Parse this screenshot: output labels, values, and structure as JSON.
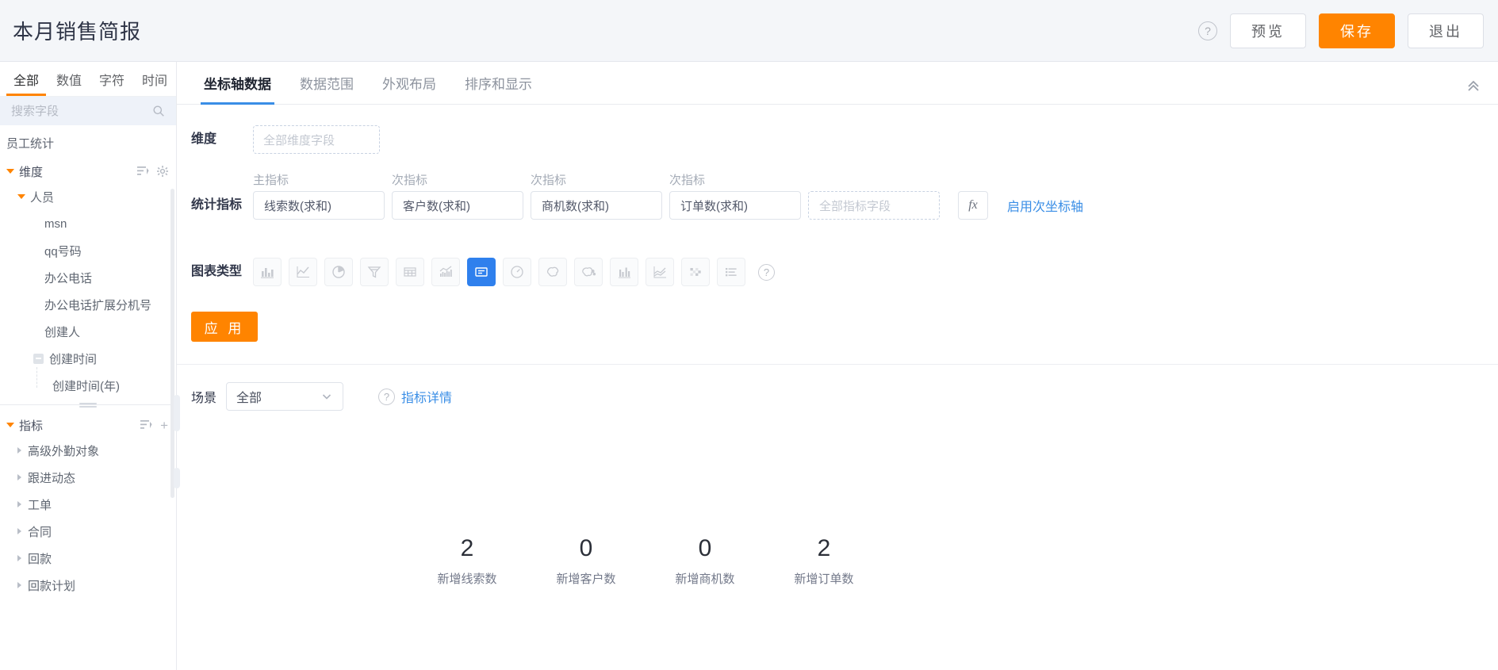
{
  "header": {
    "title": "本月销售简报",
    "help_icon": "question-circle-icon",
    "buttons": [
      {
        "label": "预览",
        "style": "outline"
      },
      {
        "label": "保存",
        "style": "primary"
      },
      {
        "label": "退出",
        "style": "outline"
      }
    ]
  },
  "sidebar": {
    "field_tabs": [
      {
        "label": "全部",
        "active": true
      },
      {
        "label": "数值",
        "active": false
      },
      {
        "label": "字符",
        "active": false
      },
      {
        "label": "时间",
        "active": false
      }
    ],
    "search": {
      "placeholder": "搜索字段",
      "value": "",
      "icon": "search-icon"
    },
    "dataset_name": "员工统计",
    "dimension_group": {
      "label": "维度",
      "filter_icon": "filter-sort-icon",
      "settings_icon": "gear-icon",
      "children": [
        {
          "label": "人员",
          "level": 1,
          "expanded": true
        },
        {
          "label": "msn",
          "level": 2
        },
        {
          "label": "qq号码",
          "level": 2
        },
        {
          "label": "办公电话",
          "level": 2
        },
        {
          "label": "办公电话扩展分机号",
          "level": 2
        },
        {
          "label": "创建人",
          "level": 2
        },
        {
          "label": "创建时间",
          "level": 2,
          "collapsible": true
        },
        {
          "label": "创建时间(年)",
          "level": 3
        }
      ]
    },
    "metric_group": {
      "label": "指标",
      "filter_icon": "filter-sort-icon",
      "add_icon": "plus-icon",
      "children": [
        {
          "label": "高级外勤对象"
        },
        {
          "label": "跟进动态"
        },
        {
          "label": "工单"
        },
        {
          "label": "合同"
        },
        {
          "label": "回款"
        },
        {
          "label": "回款计划"
        }
      ]
    }
  },
  "main": {
    "tabs": [
      {
        "label": "坐标轴数据",
        "active": true
      },
      {
        "label": "数据范围",
        "active": false
      },
      {
        "label": "外观布局",
        "active": false
      },
      {
        "label": "排序和显示",
        "active": false
      }
    ],
    "collapse_icon": "chevron-double-up-icon",
    "dimension": {
      "label": "维度",
      "placeholder": "全部维度字段"
    },
    "metrics": {
      "label": "统计指标",
      "column_labels": [
        "主指标",
        "次指标",
        "次指标",
        "次指标"
      ],
      "values": [
        "线索数(求和)",
        "客户数(求和)",
        "商机数(求和)",
        "订单数(求和)"
      ],
      "empty_placeholder": "全部指标字段",
      "fx_label": "fx",
      "secondary_axis_link": "启用次坐标轴"
    },
    "chart_type": {
      "label": "图表类型",
      "help_icon": "question-circle-icon",
      "options": [
        {
          "name": "bar-chart-icon",
          "selected": false
        },
        {
          "name": "line-chart-icon",
          "selected": false
        },
        {
          "name": "pie-chart-icon",
          "selected": false
        },
        {
          "name": "funnel-chart-icon",
          "selected": false
        },
        {
          "name": "table-icon",
          "selected": false
        },
        {
          "name": "area-chart-icon",
          "selected": false
        },
        {
          "name": "indicator-card-icon",
          "selected": true
        },
        {
          "name": "gauge-chart-icon",
          "selected": false
        },
        {
          "name": "map-chart-icon",
          "selected": false
        },
        {
          "name": "map-scatter-chart-icon",
          "selected": false
        },
        {
          "name": "grouped-bar-chart-icon",
          "selected": false
        },
        {
          "name": "multi-line-chart-icon",
          "selected": false
        },
        {
          "name": "heatmap-chart-icon",
          "selected": false
        },
        {
          "name": "list-chart-icon",
          "selected": false
        }
      ]
    },
    "apply_button": "应 用",
    "scene": {
      "label": "场景",
      "value": "全部",
      "chevron_icon": "chevron-down-icon",
      "detail_help_icon": "question-circle-icon",
      "detail_link": "指标详情"
    }
  },
  "chart_data": {
    "type": "table",
    "title": "",
    "categories": [
      "新增线索数",
      "新增客户数",
      "新增商机数",
      "新增订单数"
    ],
    "values": [
      2,
      0,
      0,
      2
    ],
    "display": "kpi-cards"
  }
}
